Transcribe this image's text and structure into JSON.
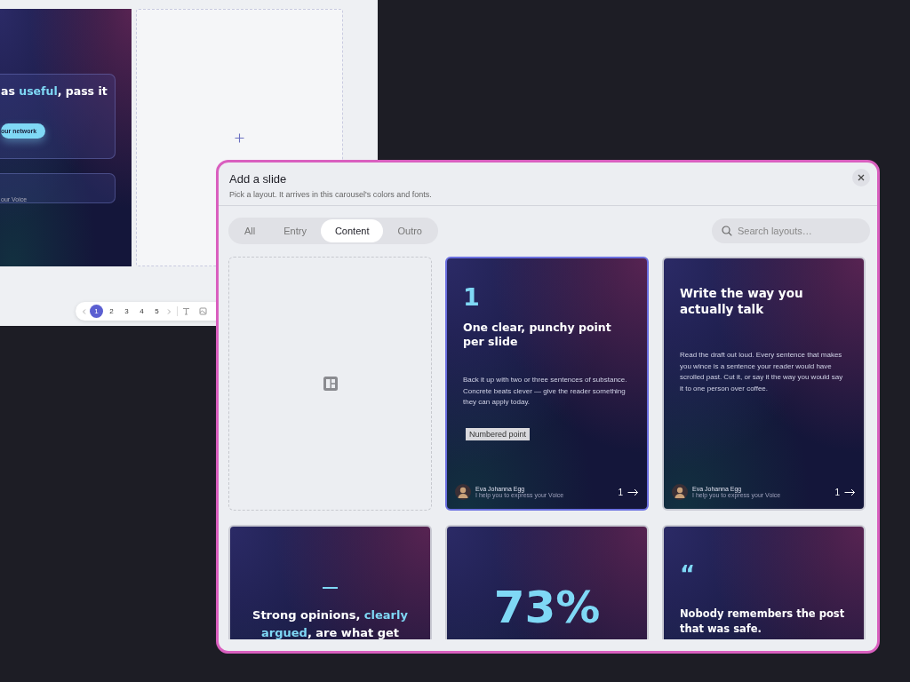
{
  "editor": {
    "slide": {
      "headline": [
        {
          "text": "as "
        },
        {
          "text": "useful",
          "accent": true
        },
        {
          "text": ", pass it"
        }
      ],
      "button": "our network",
      "footer": "our Voice"
    },
    "pages": [
      {
        "label": "1",
        "selected": true
      },
      {
        "label": "2",
        "selected": false
      },
      {
        "label": "3",
        "selected": false
      },
      {
        "label": "4",
        "selected": false
      },
      {
        "label": "5",
        "selected": false
      }
    ]
  },
  "dialog": {
    "title": "Add a slide",
    "subtitle": "Pick a layout. It arrives in this carousel's colors and fonts.",
    "tabs": [
      {
        "label": "All",
        "selected": false
      },
      {
        "label": "Entry",
        "selected": false
      },
      {
        "label": "Content",
        "selected": true
      },
      {
        "label": "Outro",
        "selected": false
      }
    ],
    "search": {
      "placeholder": "Search layouts…"
    },
    "layouts": [
      {
        "kind": "blank",
        "selected": false
      },
      {
        "kind": "numbered",
        "selected": true,
        "number": "1",
        "title": "One clear, punchy point per slide",
        "body": "Back it up with two or three sentences of substance. Concrete beats clever — give the reader something they can apply today.",
        "tag": "Numbered point",
        "author": "Eva Johanna Egg",
        "tagline": "I help you to express your Voice",
        "page": "1"
      },
      {
        "kind": "text",
        "selected": false,
        "title": "Write the way you actually talk",
        "body": "Read the draft out loud. Every sentence that makes you wince is a sentence your reader would have scrolled past. Cut it, or say it the way you would say it to one person over coffee.",
        "author": "Eva Johanna Egg",
        "tagline": "I help you to express your Voice",
        "page": "1"
      },
      {
        "kind": "statement",
        "selected": false,
        "title": [
          {
            "text": "Strong opinions, "
          },
          {
            "text": "clearly argued",
            "accent": true
          },
          {
            "text": ", are what get"
          }
        ]
      },
      {
        "kind": "stat",
        "selected": false,
        "value": "73%"
      },
      {
        "kind": "quote",
        "selected": false,
        "mark": "“",
        "title": "Nobody remembers the post that was safe."
      }
    ]
  }
}
